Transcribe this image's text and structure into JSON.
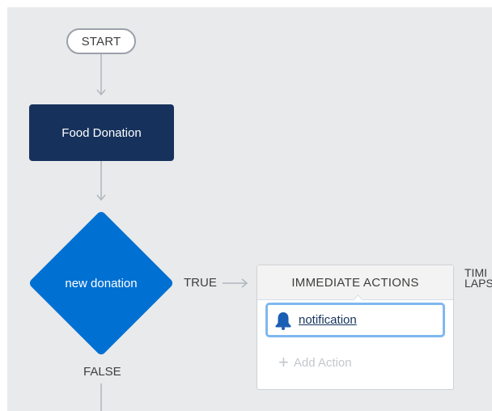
{
  "nodes": {
    "start": "START",
    "process": "Food Donation",
    "decision": "new donation"
  },
  "branches": {
    "true_label": "TRUE",
    "false_label": "FALSE"
  },
  "immediate_actions": {
    "header": "IMMEDIATE ACTIONS",
    "items": [
      {
        "label": "notification",
        "icon": "bell-icon"
      }
    ],
    "add_action_label": "Add Action"
  },
  "time_lapse": {
    "line1": "TIMI",
    "line2": "LAPS"
  },
  "colors": {
    "canvas": "#e9eaec",
    "process_node": "#16325c",
    "decision_node": "#0070d2",
    "connector": "#b0b6be",
    "action_focus": "#7fb8f0"
  }
}
